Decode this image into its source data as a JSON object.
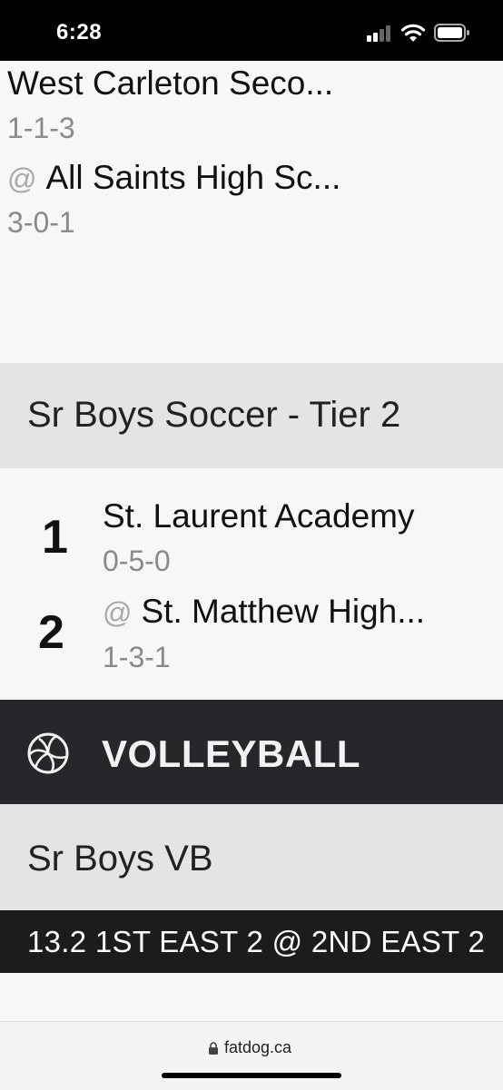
{
  "status_bar": {
    "time": "6:28"
  },
  "top_game": {
    "home_team": {
      "name": "West Carleton Seco...",
      "record": "1-1-3"
    },
    "away_team": {
      "at": "@",
      "name": "All Saints High Sc...",
      "record": "3-0-1"
    }
  },
  "section_soccer": {
    "title": "Sr Boys Soccer - Tier 2"
  },
  "ranked_game": {
    "team1": {
      "rank": "1",
      "name": "St. Laurent Academy",
      "record": "0-5-0"
    },
    "team2": {
      "rank": "2",
      "at": "@",
      "name": "St. Matthew High...",
      "record": "1-3-1"
    }
  },
  "sport_banner": {
    "icon": "volleyball-icon",
    "title": "VOLLEYBALL"
  },
  "section_vb": {
    "title": "Sr Boys VB"
  },
  "score_bar": {
    "text": "13.2 1ST EAST 2 @ 2ND EAST 2"
  },
  "browser": {
    "url": "fatdog.ca"
  }
}
